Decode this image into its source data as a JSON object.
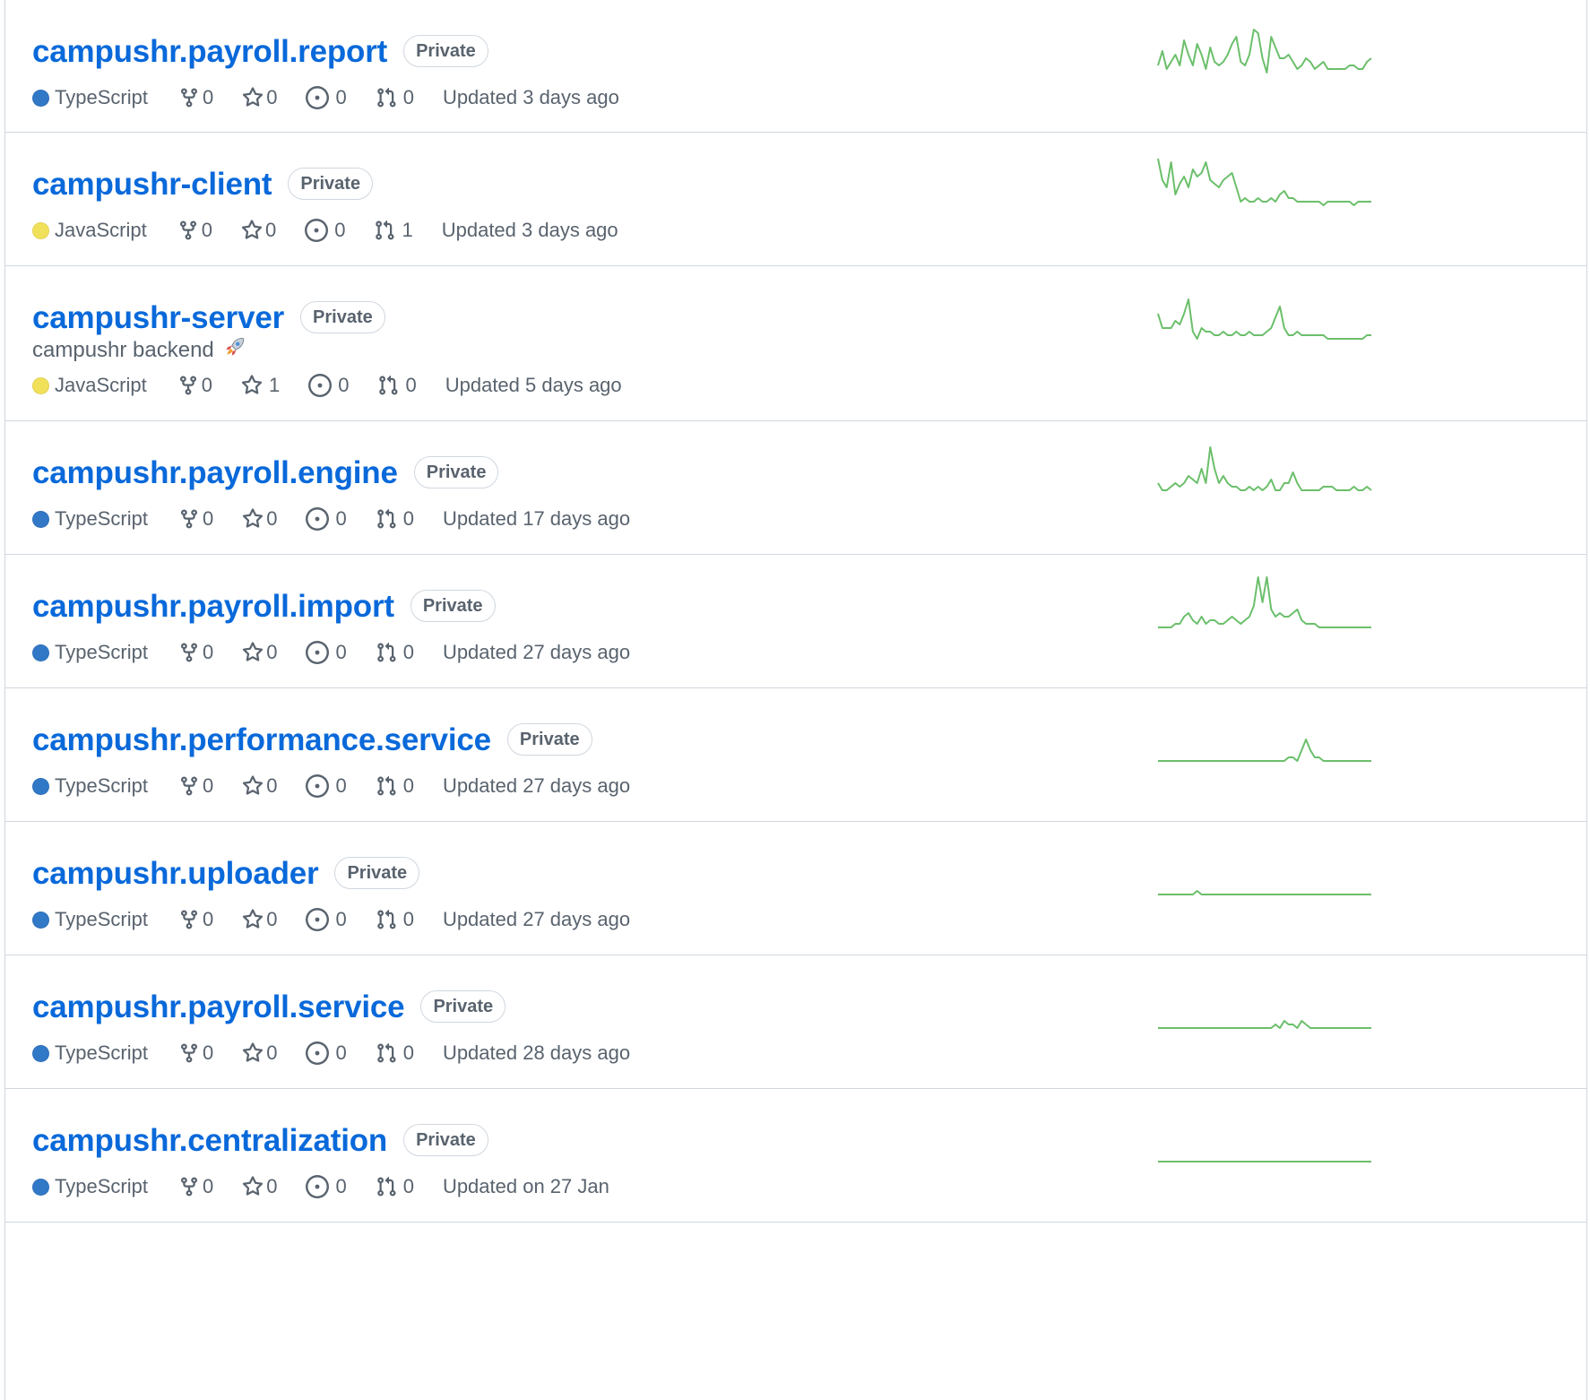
{
  "badge_label": "Private",
  "language_colors": {
    "TypeScript": "#3178c6",
    "JavaScript": "#f1e05a"
  },
  "repos": [
    {
      "name": "campushr.payroll.report",
      "visibility": "Private",
      "description": "",
      "language": "TypeScript",
      "forks": "0",
      "stars": "0",
      "issues": "0",
      "pulls": "0",
      "updated": "Updated 3 days ago",
      "activity": [
        2,
        6,
        1,
        3,
        5,
        2,
        9,
        5,
        2,
        8,
        5,
        1,
        7,
        3,
        2,
        3,
        5,
        8,
        10,
        3,
        2,
        5,
        12,
        11,
        4,
        0,
        10,
        7,
        4,
        4,
        5,
        3,
        1,
        2,
        4,
        3,
        1,
        2,
        3,
        1,
        1,
        1,
        1,
        1,
        2,
        2,
        1,
        1,
        3,
        4
      ]
    },
    {
      "name": "campushr-client",
      "visibility": "Private",
      "description": "",
      "language": "JavaScript",
      "forks": "0",
      "stars": "0",
      "issues": "0",
      "pulls": "1",
      "updated": "Updated 3 days ago",
      "activity": [
        13,
        7,
        5,
        12,
        3,
        6,
        8,
        5,
        10,
        8,
        9,
        12,
        7,
        6,
        5,
        7,
        8,
        9,
        5,
        1,
        2,
        1,
        1,
        2,
        1,
        1,
        2,
        1,
        3,
        4,
        2,
        2,
        1,
        1,
        1,
        1,
        1,
        1,
        0,
        1,
        1,
        1,
        1,
        1,
        1,
        0,
        1,
        1,
        1,
        1
      ]
    },
    {
      "name": "campushr-server",
      "visibility": "Private",
      "description": "campushr backend",
      "language": "JavaScript",
      "forks": "0",
      "stars": "1",
      "issues": "0",
      "pulls": "0",
      "updated": "Updated 5 days ago",
      "activity": [
        7,
        3,
        3,
        3,
        5,
        4,
        7,
        11,
        2,
        0,
        3,
        2,
        2,
        1,
        1,
        2,
        1,
        1,
        2,
        1,
        1,
        2,
        1,
        1,
        1,
        2,
        3,
        6,
        9,
        3,
        1,
        1,
        2,
        1,
        1,
        1,
        1,
        1,
        1,
        0,
        0,
        0,
        0,
        0,
        0,
        0,
        0,
        0,
        1,
        1
      ]
    },
    {
      "name": "campushr.payroll.engine",
      "visibility": "Private",
      "description": "",
      "language": "TypeScript",
      "forks": "0",
      "stars": "0",
      "issues": "0",
      "pulls": "0",
      "updated": "Updated 17 days ago",
      "activity": [
        3,
        1,
        1,
        2,
        3,
        2,
        3,
        5,
        4,
        3,
        7,
        3,
        13,
        7,
        3,
        5,
        3,
        2,
        2,
        1,
        1,
        2,
        1,
        2,
        1,
        2,
        4,
        1,
        1,
        3,
        3,
        6,
        3,
        1,
        1,
        1,
        1,
        1,
        2,
        2,
        2,
        1,
        1,
        1,
        1,
        2,
        1,
        1,
        2,
        1
      ]
    },
    {
      "name": "campushr.payroll.import",
      "visibility": "Private",
      "description": "",
      "language": "TypeScript",
      "forks": "0",
      "stars": "0",
      "issues": "0",
      "pulls": "0",
      "updated": "Updated 27 days ago",
      "activity": [
        0,
        0,
        0,
        0,
        1,
        1,
        3,
        4,
        2,
        1,
        3,
        1,
        2,
        2,
        1,
        1,
        2,
        3,
        2,
        1,
        2,
        3,
        6,
        14,
        7,
        14,
        5,
        3,
        4,
        3,
        3,
        4,
        5,
        2,
        1,
        1,
        1,
        0,
        0,
        0,
        0,
        0,
        0,
        0,
        0,
        0,
        0,
        0,
        0,
        0
      ]
    },
    {
      "name": "campushr.performance.service",
      "visibility": "Private",
      "description": "",
      "language": "TypeScript",
      "forks": "0",
      "stars": "0",
      "issues": "0",
      "pulls": "0",
      "updated": "Updated 27 days ago",
      "activity": [
        0,
        0,
        0,
        0,
        0,
        0,
        0,
        0,
        0,
        0,
        0,
        0,
        0,
        0,
        0,
        0,
        0,
        0,
        0,
        0,
        0,
        0,
        0,
        0,
        0,
        0,
        0,
        0,
        0,
        0,
        1,
        1,
        0,
        3,
        6,
        3,
        1,
        1,
        0,
        0,
        0,
        0,
        0,
        0,
        0,
        0,
        0,
        0,
        0,
        0
      ]
    },
    {
      "name": "campushr.uploader",
      "visibility": "Private",
      "description": "",
      "language": "TypeScript",
      "forks": "0",
      "stars": "0",
      "issues": "0",
      "pulls": "0",
      "updated": "Updated 27 days ago",
      "activity": [
        0,
        0,
        0,
        0,
        0,
        0,
        0,
        0,
        0,
        1,
        0,
        0,
        0,
        0,
        0,
        0,
        0,
        0,
        0,
        0,
        0,
        0,
        0,
        0,
        0,
        0,
        0,
        0,
        0,
        0,
        0,
        0,
        0,
        0,
        0,
        0,
        0,
        0,
        0,
        0,
        0,
        0,
        0,
        0,
        0,
        0,
        0,
        0,
        0,
        0
      ]
    },
    {
      "name": "campushr.payroll.service",
      "visibility": "Private",
      "description": "",
      "language": "TypeScript",
      "forks": "0",
      "stars": "0",
      "issues": "0",
      "pulls": "0",
      "updated": "Updated 28 days ago",
      "activity": [
        0,
        0,
        0,
        0,
        0,
        0,
        0,
        0,
        0,
        0,
        0,
        0,
        0,
        0,
        0,
        0,
        0,
        0,
        0,
        0,
        0,
        0,
        0,
        0,
        0,
        0,
        0,
        1,
        0,
        2,
        1,
        1,
        0,
        2,
        1,
        0,
        0,
        0,
        0,
        0,
        0,
        0,
        0,
        0,
        0,
        0,
        0,
        0,
        0,
        0
      ]
    },
    {
      "name": "campushr.centralization",
      "visibility": "Private",
      "description": "",
      "language": "TypeScript",
      "forks": "0",
      "stars": "0",
      "issues": "0",
      "pulls": "0",
      "updated": "Updated on 27 Jan",
      "activity": [
        0,
        0,
        0,
        0,
        0,
        0,
        0,
        0,
        0,
        0,
        0,
        0,
        0,
        0,
        0,
        0,
        0,
        0,
        0,
        0,
        0,
        0,
        0,
        0,
        0,
        0,
        0,
        0,
        0,
        0,
        0,
        0,
        0,
        0,
        0,
        0,
        0,
        0,
        0,
        0,
        0,
        0,
        0,
        0,
        0,
        0,
        0,
        0,
        0,
        0
      ]
    }
  ]
}
